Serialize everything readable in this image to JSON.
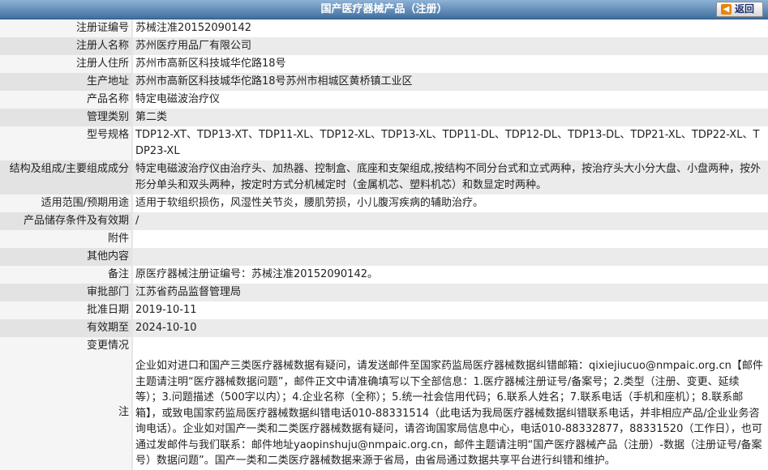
{
  "header": {
    "title": "国产医疗器械产品（注册）",
    "back_label": "返回"
  },
  "rows": [
    {
      "label": "注册证编号",
      "value": "苏械注准20152090142"
    },
    {
      "label": "注册人名称",
      "value": "苏州医疗用品厂有限公司"
    },
    {
      "label": "注册人住所",
      "value": "苏州市高新区科技城华佗路18号"
    },
    {
      "label": "生产地址",
      "value": "苏州市高新区科技城华佗路18号苏州市相城区黄桥镇工业区"
    },
    {
      "label": "产品名称",
      "value": "特定电磁波治疗仪"
    },
    {
      "label": "管理类别",
      "value": "第二类"
    },
    {
      "label": "型号规格",
      "value": "TDP12-XT、TDP13-XT、TDP11-XL、TDP12-XL、TDP13-XL、TDP11-DL、TDP12-DL、TDP13-DL、TDP21-XL、TDP22-XL、TDP23-XL"
    },
    {
      "label": "结构及组成/主要组成成分",
      "value": "特定电磁波治疗仪由治疗头、加热器、控制盒、底座和支架组成,按结构不同分台式和立式两种，按治疗头大小分大盘、小盘两种，按外形分单头和双头两种，按定时方式分机械定时（金属机芯、塑料机芯）和数显定时两种。"
    },
    {
      "label": "适用范围/预期用途",
      "value": "适用于软组织损伤，风湿性关节炎，腰肌劳损，小儿腹泻疾病的辅助治疗。"
    },
    {
      "label": "产品储存条件及有效期",
      "value": "/"
    },
    {
      "label": "附件",
      "value": ""
    },
    {
      "label": "其他内容",
      "value": ""
    },
    {
      "label": "备注",
      "value": "原医疗器械注册证编号：苏械注准20152090142。"
    },
    {
      "label": "审批部门",
      "value": "江苏省药品监督管理局"
    },
    {
      "label": "批准日期",
      "value": "2019-10-11"
    },
    {
      "label": "有效期至",
      "value": "2024-10-10"
    },
    {
      "label": "变更情况",
      "value": ""
    }
  ],
  "notes": {
    "label": "注",
    "text": "企业如对进口和国产三类医疗器械数据有疑问，请发送邮件至国家药监局医疗器械数据纠错邮箱：qixiejiucuo@nmpaic.org.cn【邮件主题请注明“医疗器械数据问题”，邮件正文中请准确填写以下全部信息：1.医疗器械注册证号/备案号；2.类型（注册、变更、延续等）；3.问题描述（500字以内）；4.企业名称（全称）；5.统一社会信用代码；6.联系人姓名；7.联系电话（手机和座机）；8.联系邮箱】，或致电国家药监局医疗器械数据纠错电话010-88331514（此电话为我局医疗器械数据纠错联系电话，并非相应产品/企业业务咨询电话）。企业如对国产一类和二类医疗器械数据有疑问，请咨询国家局信息中心，电话010-88332877，88331520（工作日），也可通过发邮件与我们联系：邮件地址yaopinshuju@nmpaic.org.cn，邮件主题请注明“国产医疗器械产品（注册）-数据（注册证号/备案号）数据问题”。国产一类和二类医疗器械数据来源于省局，由省局通过数据共享平台进行纠错和维护。"
  }
}
